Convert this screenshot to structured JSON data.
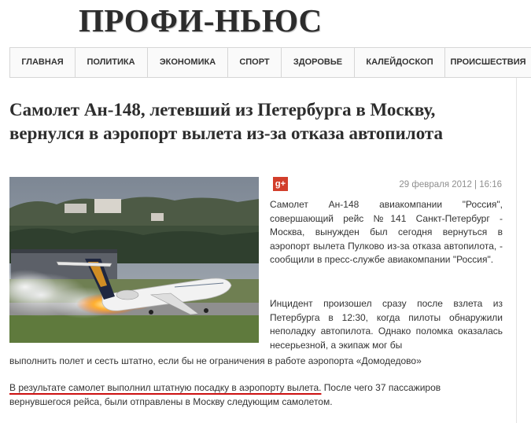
{
  "site": {
    "logo": "ПРОФИ-НЬЮС"
  },
  "nav": {
    "items": [
      {
        "label": "ГЛАВНАЯ"
      },
      {
        "label": "ПОЛИТИКА"
      },
      {
        "label": "ЭКОНОМИКА"
      },
      {
        "label": "СПОРТ"
      },
      {
        "label": "ЗДОРОВЬЕ"
      },
      {
        "label": "КАЛЕЙДОСКОП"
      },
      {
        "label": "ПРОИСШЕСТВИЯ"
      }
    ]
  },
  "article": {
    "title": "Самолет Ан-148, летевший из Петербурга в Москву, вернулся в аэропорт вылета из-за отказа автопилота",
    "date": "29 февраля 2012 | 16:16",
    "share_icon": "google-plus-icon",
    "share_label": "g+",
    "photo_caption_text": "Lufthansa",
    "paragraphs": {
      "p1": "Самолет Ан-148 авиакомпании \"Россия\", совершающий рейс №141 Санкт-Петербург - Москва, вынужден был сегодня вернуться в аэропорт вылета Пулково из-за отказа автопилота, - сообщили в пресс-службе авиакомпании \"Россия\".",
      "p2": "Инцидент произошел сразу после взлета из Петербурга в 12:30, когда пилоты обнаружили неполадку автопилота. Однако поломка оказалась несерьезной, а экипаж мог бы",
      "p2_end": "выполнить полет и сесть штатно, если бы не ограничения в работе аэропорта «Домодедово»",
      "p3_highlight": "В результате самолет выполнил штатную посадку в аэропорту вылета.",
      "p3_rest": " После чего 37 пассажиров",
      "p3_end": "вернувшегося рейса, были отправлены в Москву следующим самолетом."
    }
  },
  "colors": {
    "highlight_underline": "#cc1111",
    "share_icon_bg": "#d23e2b"
  }
}
